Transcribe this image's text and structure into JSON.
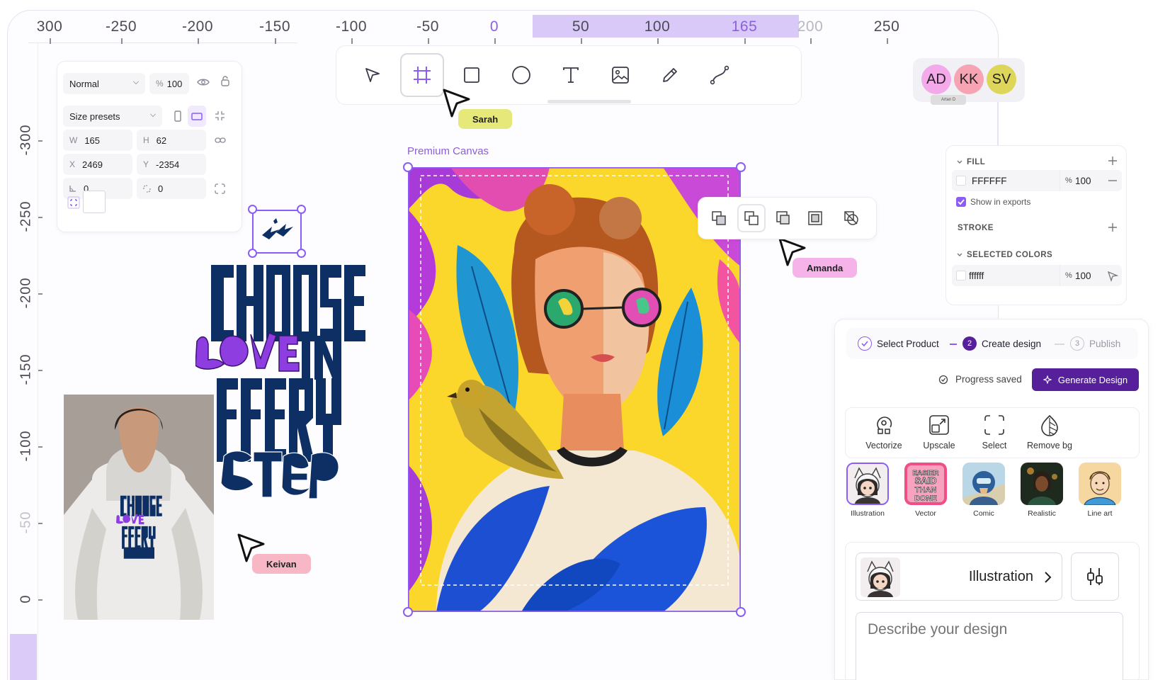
{
  "ruler_top": {
    "labels": [
      {
        "text": "300",
        "faded": false,
        "hl": false
      },
      {
        "text": "-250",
        "faded": false,
        "hl": false
      },
      {
        "text": "-200",
        "faded": false,
        "hl": false
      },
      {
        "text": "-150",
        "faded": false,
        "hl": false
      },
      {
        "text": "-100",
        "faded": false,
        "hl": false
      },
      {
        "text": "-50",
        "faded": false,
        "hl": false
      },
      {
        "text": "0",
        "faded": false,
        "hl": true
      },
      {
        "text": "50",
        "faded": false,
        "hl": false
      },
      {
        "text": "100",
        "faded": false,
        "hl": false
      },
      {
        "text": "165",
        "faded": false,
        "hl": true
      },
      {
        "text": "200",
        "faded": true,
        "hl": false
      },
      {
        "text": "250",
        "faded": false,
        "hl": false
      }
    ]
  },
  "ruler_left": {
    "labels": [
      {
        "text": "-300",
        "faded": false
      },
      {
        "text": "-250",
        "faded": false
      },
      {
        "text": "-200",
        "faded": false
      },
      {
        "text": "-150",
        "faded": false
      },
      {
        "text": "-100",
        "faded": false
      },
      {
        "text": "-50",
        "faded": true
      },
      {
        "text": "0",
        "faded": false
      }
    ]
  },
  "props": {
    "blend_mode": "Normal",
    "opacity_prefix": "%",
    "opacity": "100",
    "size_presets": "Size presets",
    "w_label": "W",
    "w": "165",
    "h_label": "H",
    "h": "62",
    "x_label": "X",
    "x": "2469",
    "y_label": "Y",
    "y": "-2354",
    "rotation": "0",
    "radius": "0"
  },
  "toolbar": {
    "tools": [
      "pointer-icon",
      "frame-icon",
      "rectangle-icon",
      "ellipse-icon",
      "text-icon",
      "image-icon",
      "pencil-icon",
      "path-icon"
    ],
    "active_index": 1
  },
  "cursors": {
    "sarah": "Sarah",
    "amanda": "Amanda",
    "keivan": "Keivan"
  },
  "collaborators": {
    "items": [
      {
        "initials": "AD",
        "color": "#f4a9ea"
      },
      {
        "initials": "KK",
        "color": "#f6a3b3"
      },
      {
        "initials": "SV",
        "color": "#ddd65a"
      }
    ],
    "caption": "Artan D"
  },
  "canvas": {
    "title": "Premium Canvas"
  },
  "fill_panel": {
    "fill_title": "FILL",
    "fill_hex": "FFFFFF",
    "fill_opacity_prefix": "%",
    "fill_opacity": "100",
    "show_in_exports": "Show in exports",
    "stroke_title": "STROKE",
    "selected_colors_title": "SELECTED COLORS",
    "selected_hex": "ffffff",
    "selected_opacity_prefix": "%",
    "selected_opacity": "100"
  },
  "creator": {
    "steps": [
      {
        "num": "",
        "label": "Select Product",
        "state": "done"
      },
      {
        "num": "2",
        "label": "Create design",
        "state": "active"
      },
      {
        "num": "3",
        "label": "Publish",
        "state": "todo"
      }
    ],
    "progress_saved": "Progress saved",
    "generate_label": "Generate Design",
    "tools": [
      "Vectorize",
      "Upscale",
      "Select",
      "Remove bg"
    ],
    "styles": [
      "Illustration",
      "Vector",
      "Comic",
      "Realistic",
      "Line art"
    ],
    "selected_style": "Illustration",
    "prompt_placeholder": "Describe your design"
  },
  "artwork": {
    "vector_style_text": "EASIER SAID THAN DONE"
  },
  "colors": {
    "accent": "#8b5cf6",
    "generate_button": "#56209a",
    "ruler_highlight": "#d9c9f8",
    "sarah_tag": "#e6e87a",
    "amanda_tag": "#f6b3ea",
    "keivan_tag": "#f7b7c4",
    "typography_navy": "#0d2f63",
    "typography_purple": "#8e3ee0"
  }
}
